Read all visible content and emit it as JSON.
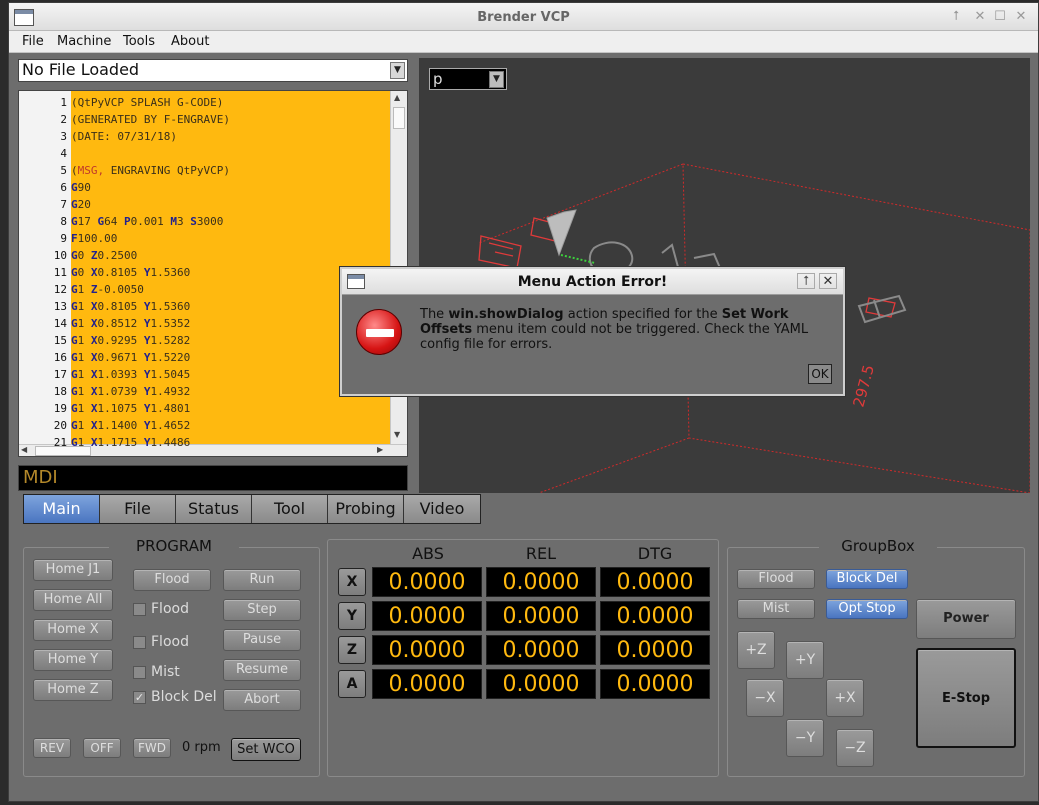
{
  "window": {
    "title": "Brender VCP",
    "controls": [
      "⭡",
      "✕",
      "☐",
      "✕"
    ]
  },
  "menu": [
    "File",
    "Machine",
    "Tools",
    "About"
  ],
  "file_combo": {
    "value": "No File Loaded"
  },
  "editor": {
    "lines": [
      {
        "n": "1",
        "text": "(QtPyVCP SPLASH G-CODE)"
      },
      {
        "n": "2",
        "text": "(GENERATED BY F-ENGRAVE)"
      },
      {
        "n": "3",
        "text": "(DATE: 07/31/18)"
      },
      {
        "n": "4",
        "text": ""
      },
      {
        "n": "5",
        "text": "(MSG, ENGRAVING QtPyVCP)"
      },
      {
        "n": "6",
        "text": "G90"
      },
      {
        "n": "7",
        "text": "G20"
      },
      {
        "n": "8",
        "text": "G17 G64 P0.001 M3 S3000"
      },
      {
        "n": "9",
        "text": "F100.00"
      },
      {
        "n": "10",
        "text": "G0 Z0.2500"
      },
      {
        "n": "11",
        "text": "G0 X0.8105 Y1.5360"
      },
      {
        "n": "12",
        "text": "G1 Z-0.0050"
      },
      {
        "n": "13",
        "text": "G1 X0.8105 Y1.5360"
      },
      {
        "n": "14",
        "text": "G1 X0.8512 Y1.5352"
      },
      {
        "n": "15",
        "text": "G1 X0.9295 Y1.5282"
      },
      {
        "n": "16",
        "text": "G1 X0.9671 Y1.5220"
      },
      {
        "n": "17",
        "text": "G1 X1.0393 Y1.5045"
      },
      {
        "n": "18",
        "text": "G1 X1.0739 Y1.4932"
      },
      {
        "n": "19",
        "text": "G1 X1.1075 Y1.4801"
      },
      {
        "n": "20",
        "text": "G1 X1.1400 Y1.4652"
      },
      {
        "n": "21",
        "text": "G1 X1.1715 Y1.4486"
      }
    ]
  },
  "mdi": {
    "placeholder": "MDI"
  },
  "preview": {
    "view_combo": "p",
    "dimension_label": "297.5"
  },
  "tabs": [
    {
      "label": "Main",
      "active": true
    },
    {
      "label": "File",
      "active": false
    },
    {
      "label": "Status",
      "active": false
    },
    {
      "label": "Tool",
      "active": false
    },
    {
      "label": "Probing",
      "active": false
    },
    {
      "label": "Video",
      "active": false
    }
  ],
  "program": {
    "title": "PROGRAM",
    "home_buttons": [
      "Home J1",
      "Home All",
      "Home X",
      "Home Y",
      "Home Z"
    ],
    "flood_button": "Flood",
    "checkboxes": [
      {
        "label": "Flood",
        "checked": false
      },
      {
        "label": "Flood",
        "checked": false
      },
      {
        "label": "Mist",
        "checked": false
      },
      {
        "label": "Block Del",
        "checked": true
      }
    ],
    "run_buttons": [
      "Run",
      "Step",
      "Pause",
      "Resume",
      "Abort"
    ],
    "spindle_buttons": [
      "REV",
      "OFF",
      "FWD"
    ],
    "rpm": "0 rpm",
    "set_wco": "Set WCO"
  },
  "dro": {
    "headers": [
      "ABS",
      "REL",
      "DTG"
    ],
    "rows": [
      {
        "axis": "X",
        "abs": "0.0000",
        "rel": "0.0000",
        "dtg": "0.0000"
      },
      {
        "axis": "Y",
        "abs": "0.0000",
        "rel": "0.0000",
        "dtg": "0.0000"
      },
      {
        "axis": "Z",
        "abs": "0.0000",
        "rel": "0.0000",
        "dtg": "0.0000"
      },
      {
        "axis": "A",
        "abs": "0.0000",
        "rel": "0.0000",
        "dtg": "0.0000"
      }
    ]
  },
  "groupbox": {
    "title": "GroupBox",
    "flood": "Flood",
    "block_del": "Block Del",
    "mist": "Mist",
    "opt_stop": "Opt Stop",
    "power": "Power",
    "estop": "E-Stop",
    "jog": {
      "zplus": "+Z",
      "yplus": "+Y",
      "xminus": "−X",
      "xplus": "+X",
      "yminus": "−Y",
      "zminus": "−Z"
    }
  },
  "dialog": {
    "title": "Menu Action Error!",
    "controls": [
      "⭡",
      "✕"
    ],
    "msg_1": "The ",
    "msg_bold_1": "win.showDialog",
    "msg_2": " action specified for the ",
    "msg_bold_2": "Set Work Offsets",
    "msg_3": " menu item could not be triggered. Check the YAML config file for errors.",
    "ok": "OK"
  },
  "colors": {
    "editor_bg": "#ffb90f",
    "dro_text": "#ffb90f",
    "accent": "#4a75c0",
    "preview_lines": "#d22a2a"
  }
}
